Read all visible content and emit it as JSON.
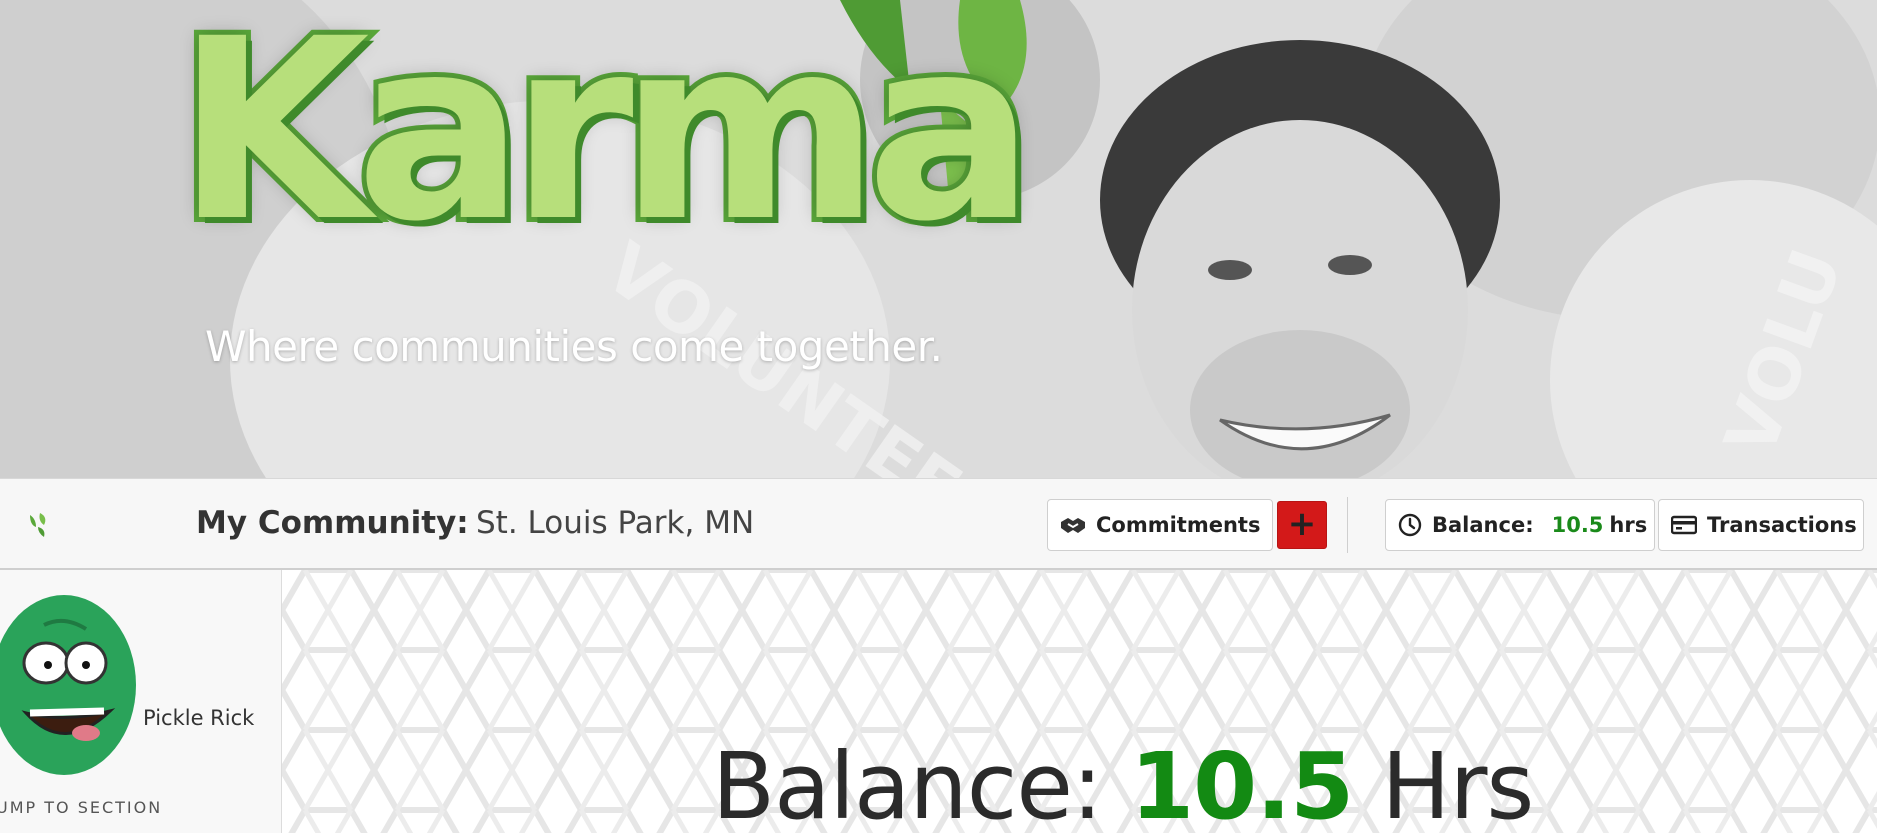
{
  "hero": {
    "title": "Karma",
    "tagline": "Where communities come together."
  },
  "navbar": {
    "community_label": "My Community:",
    "community_value": "St. Louis Park, MN",
    "commitments_label": "Commitments",
    "add_label": "+",
    "balance_label": "Balance:",
    "balance_value": "10.5",
    "balance_unit": "hrs",
    "transactions_label": "Transactions"
  },
  "sidebar": {
    "user_name": "Pickle Rick",
    "jump_label": "UMP TO SECTION"
  },
  "main": {
    "balance_label": "Balance:",
    "balance_value": "10.5",
    "balance_unit": "Hrs"
  },
  "colors": {
    "brand_green": "#5aa83a",
    "balance_green": "#138a13",
    "add_red": "#d31919"
  },
  "icons": {
    "logo": "karma-leaf-icon",
    "commitments": "handshake-icon",
    "balance": "clock-icon",
    "transactions": "credit-card-icon"
  }
}
